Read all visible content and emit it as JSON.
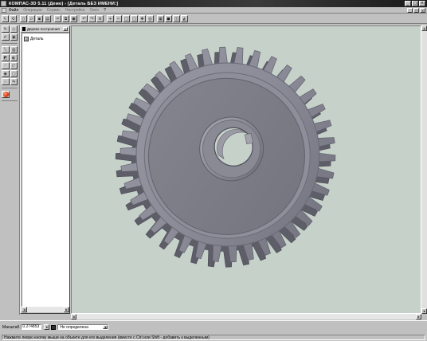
{
  "window": {
    "title": "КОМПАС-3D 5.11 (Демо) - [Деталь БЕЗ ИМЕНИ:]",
    "minimize": "_",
    "maximize": "□",
    "close": "×"
  },
  "menu": {
    "items": [
      "Файл",
      "Операции",
      "Сервис",
      "Настройка",
      "Окно",
      "?"
    ]
  },
  "tree": {
    "title": "Дерево построения",
    "root_label": "Деталь"
  },
  "propbar": {
    "scale_label": "Масштаб",
    "scale_value": "0.274853",
    "orientation_value": "Не определена"
  },
  "status": {
    "text": "Нажмите левую кнопку мыши на объекте для его выделения (вместе с Ctrl или Shift - добавить к выделенным)"
  },
  "colors": {
    "viewport_bg": "#c6d1c9",
    "gear_face": "#7b7b87",
    "gear_tooth": "#8a8a97",
    "accent_red": "#e03a10"
  },
  "gear": {
    "teeth": 38
  }
}
